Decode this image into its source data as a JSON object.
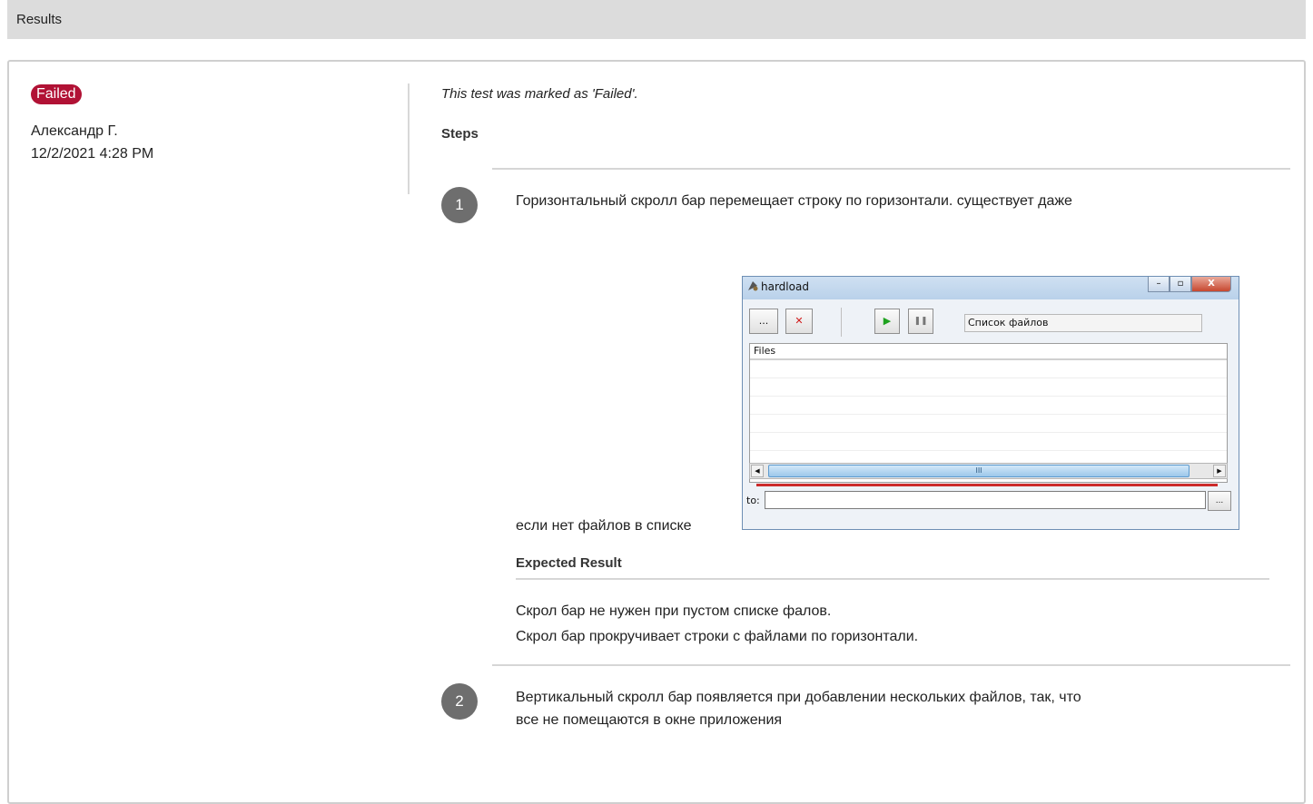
{
  "header": {
    "title": "Results"
  },
  "result": {
    "status": "Failed",
    "author": "Александр Г.",
    "timestamp": "12/2/2021 4:28 PM",
    "note": "This test was marked as 'Failed'."
  },
  "steps_title": "Steps",
  "steps": [
    {
      "number": "1",
      "text_line1": "Горизонтальный скролл бар перемещает строку по горизонтали. существует даже",
      "text_line2": "если нет файлов в списке",
      "expected_title": "Expected Result",
      "expected_line1": "Скрол бар не нужен при пустом списке фалов.",
      "expected_line2": "Скрол бар прокручивает строки с файлами по горизонтали."
    },
    {
      "number": "2",
      "text_line1": "Вертикальный скролл бар появляется при добавлении нескольких файлов, так, что",
      "text_line2": "все не помещаются в окне приложения"
    }
  ],
  "embedded_app": {
    "title": "hardload",
    "browse_label": "...",
    "stop_label": "✕",
    "play_label": "▶",
    "pause_label": "❚❚",
    "status_text": "Список файлов",
    "list_header": "Files",
    "scroll_grip": "III",
    "to_label": "to:",
    "to_browse_label": "...",
    "colors": {
      "accent_red": "#cc2b2b",
      "play_green": "#1fa21f",
      "stop_red": "#d01818"
    }
  },
  "colors": {
    "failed_badge": "#b11235",
    "step_circle": "#6e6e6e"
  }
}
